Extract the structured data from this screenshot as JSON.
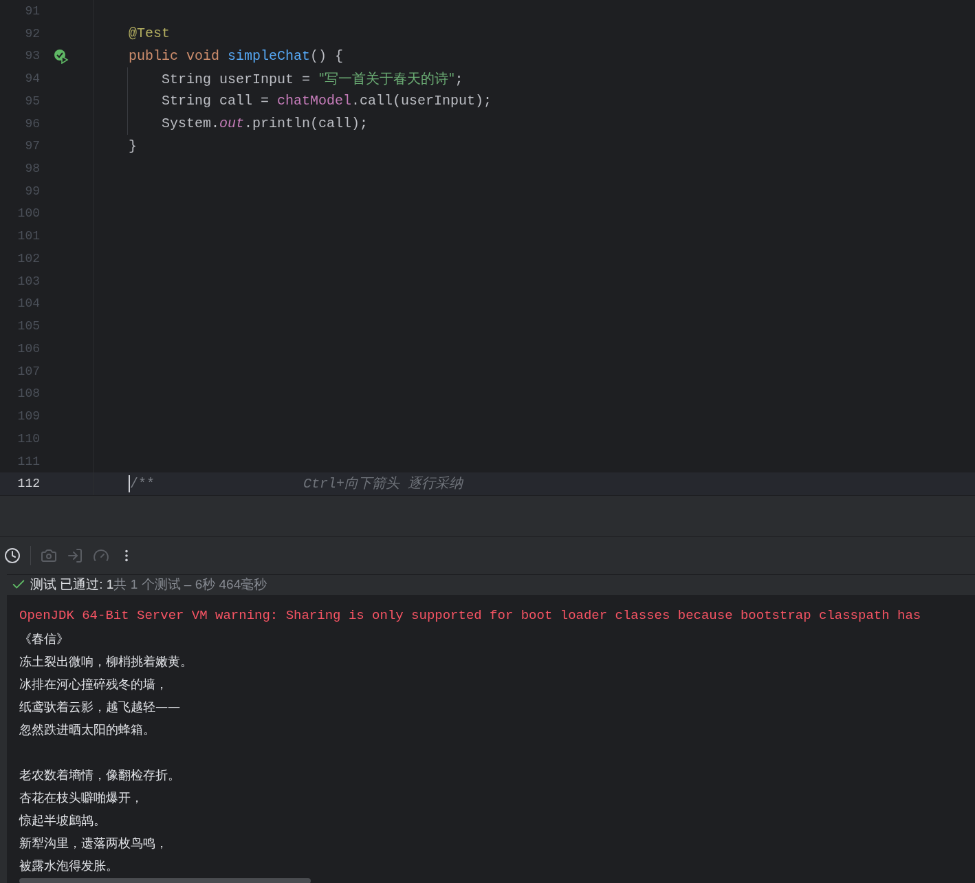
{
  "editor": {
    "lines": [
      {
        "number": "91",
        "current": false,
        "test_passed": false
      },
      {
        "number": "92",
        "current": false,
        "test_passed": false,
        "tokens": [
          {
            "text": "    @Test",
            "kind": "annotation"
          }
        ]
      },
      {
        "number": "93",
        "current": false,
        "test_passed": true,
        "tokens": [
          {
            "text": "    public void ",
            "kind": "keyword"
          },
          {
            "text": "simpleChat",
            "kind": "method"
          },
          {
            "text": "() {",
            "kind": "plain"
          }
        ]
      },
      {
        "number": "94",
        "current": false,
        "test_passed": false,
        "tokens": [
          {
            "text": "        String userInput = ",
            "kind": "plain"
          },
          {
            "text": "\"写一首关于春天的诗\"",
            "kind": "string"
          },
          {
            "text": ";",
            "kind": "plain"
          }
        ]
      },
      {
        "number": "95",
        "current": false,
        "test_passed": false,
        "tokens": [
          {
            "text": "        String call = ",
            "kind": "plain"
          },
          {
            "text": "chatModel",
            "kind": "field"
          },
          {
            "text": ".call(userInput);",
            "kind": "plain"
          }
        ]
      },
      {
        "number": "96",
        "current": false,
        "test_passed": false,
        "tokens": [
          {
            "text": "        System.",
            "kind": "plain"
          },
          {
            "text": "out",
            "kind": "static"
          },
          {
            "text": ".println(call);",
            "kind": "plain"
          }
        ]
      },
      {
        "number": "97",
        "current": false,
        "test_passed": false,
        "tokens": [
          {
            "text": "    }",
            "kind": "plain"
          }
        ]
      },
      {
        "number": "98",
        "current": false,
        "test_passed": false
      },
      {
        "number": "99",
        "current": false,
        "test_passed": false
      },
      {
        "number": "100",
        "current": false,
        "test_passed": false
      },
      {
        "number": "101",
        "current": false,
        "test_passed": false
      },
      {
        "number": "102",
        "current": false,
        "test_passed": false
      },
      {
        "number": "103",
        "current": false,
        "test_passed": false
      },
      {
        "number": "104",
        "current": false,
        "test_passed": false
      },
      {
        "number": "105",
        "current": false,
        "test_passed": false
      },
      {
        "number": "106",
        "current": false,
        "test_passed": false
      },
      {
        "number": "107",
        "current": false,
        "test_passed": false
      },
      {
        "number": "108",
        "current": false,
        "test_passed": false
      },
      {
        "number": "109",
        "current": false,
        "test_passed": false
      },
      {
        "number": "110",
        "current": false,
        "test_passed": false
      },
      {
        "number": "111",
        "current": false,
        "test_passed": false
      },
      {
        "number": "112",
        "current": true,
        "test_passed": false,
        "tokens": [
          {
            "text": "    /**",
            "kind": "comment"
          },
          {
            "text": "Ctrl+向下箭头 逐行采纳",
            "kind": "hint"
          }
        ]
      }
    ]
  },
  "test_status": {
    "passed": true,
    "result": "测试 已通过: 1",
    "summary": "共 1 个测试 – 6秒 464毫秒"
  },
  "console": {
    "lines": [
      {
        "kind": "error",
        "text": "OpenJDK 64-Bit Server VM warning: Sharing is only supported for boot loader classes because bootstrap classpath has"
      },
      {
        "kind": "output",
        "text": "《春信》"
      },
      {
        "kind": "output",
        "text": "冻土裂出微响，柳梢挑着嫩黄。"
      },
      {
        "kind": "output",
        "text": "冰排在河心撞碎残冬的墙，"
      },
      {
        "kind": "output",
        "text": "纸鸢驮着云影，越飞越轻——"
      },
      {
        "kind": "output",
        "text": "忽然跌进晒太阳的蜂箱。"
      },
      {
        "kind": "blank"
      },
      {
        "kind": "output",
        "text": "老农数着墒情，像翻检存折。"
      },
      {
        "kind": "output",
        "text": "杏花在枝头噼啪爆开，"
      },
      {
        "kind": "output",
        "text": "惊起半坡鹧鸪。"
      },
      {
        "kind": "output",
        "text": "新犁沟里，遗落两枚鸟鸣，"
      },
      {
        "kind": "output",
        "text": "被露水泡得发胀。"
      }
    ]
  }
}
